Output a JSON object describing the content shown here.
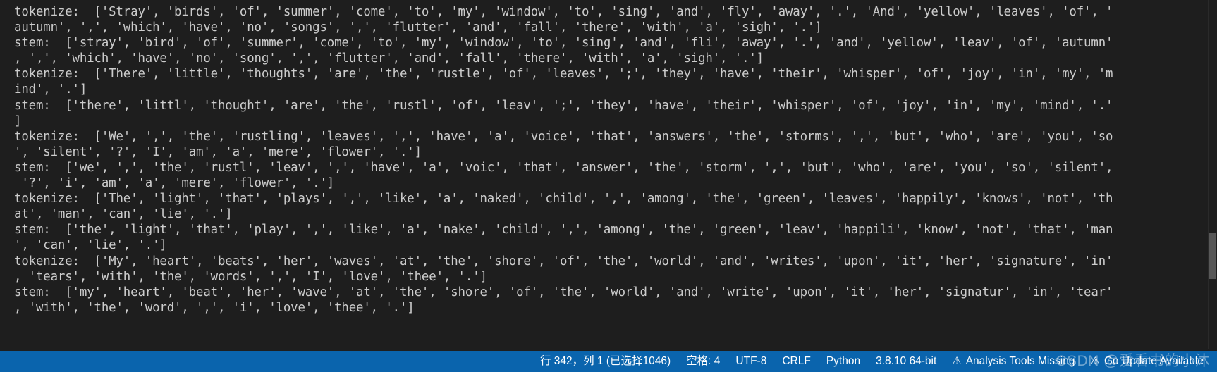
{
  "terminal": {
    "lines": [
      "tokenize:  ['Stray', 'birds', 'of', 'summer', 'come', 'to', 'my', 'window', 'to', 'sing', 'and', 'fly', 'away', '.', 'And', 'yellow', 'leaves', 'of', '",
      "autumn', ',', 'which', 'have', 'no', 'songs', ',', 'flutter', 'and', 'fall', 'there', 'with', 'a', 'sigh', '.']",
      "stem:  ['stray', 'bird', 'of', 'summer', 'come', 'to', 'my', 'window', 'to', 'sing', 'and', 'fli', 'away', '.', 'and', 'yellow', 'leav', 'of', 'autumn'",
      ", ',', 'which', 'have', 'no', 'song', ',', 'flutter', 'and', 'fall', 'there', 'with', 'a', 'sigh', '.']",
      "tokenize:  ['There', 'little', 'thoughts', 'are', 'the', 'rustle', 'of', 'leaves', ';', 'they', 'have', 'their', 'whisper', 'of', 'joy', 'in', 'my', 'm",
      "ind', '.']",
      "stem:  ['there', 'littl', 'thought', 'are', 'the', 'rustl', 'of', 'leav', ';', 'they', 'have', 'their', 'whisper', 'of', 'joy', 'in', 'my', 'mind', '.'",
      "]",
      "tokenize:  ['We', ',', 'the', 'rustling', 'leaves', ',', 'have', 'a', 'voice', 'that', 'answers', 'the', 'storms', ',', 'but', 'who', 'are', 'you', 'so",
      "', 'silent', '?', 'I', 'am', 'a', 'mere', 'flower', '.']",
      "stem:  ['we', ',', 'the', 'rustl', 'leav', ',', 'have', 'a', 'voic', 'that', 'answer', 'the', 'storm', ',', 'but', 'who', 'are', 'you', 'so', 'silent',",
      " '?', 'i', 'am', 'a', 'mere', 'flower', '.']",
      "tokenize:  ['The', 'light', 'that', 'plays', ',', 'like', 'a', 'naked', 'child', ',', 'among', 'the', 'green', 'leaves', 'happily', 'knows', 'not', 'th",
      "at', 'man', 'can', 'lie', '.']",
      "stem:  ['the', 'light', 'that', 'play', ',', 'like', 'a', 'nake', 'child', ',', 'among', 'the', 'green', 'leav', 'happili', 'know', 'not', 'that', 'man",
      "', 'can', 'lie', '.']",
      "tokenize:  ['My', 'heart', 'beats', 'her', 'waves', 'at', 'the', 'shore', 'of', 'the', 'world', 'and', 'writes', 'upon', 'it', 'her', 'signature', 'in'",
      ", 'tears', 'with', 'the', 'words', ',', 'I', 'love', 'thee', '.']",
      "stem:  ['my', 'heart', 'beat', 'her', 'wave', 'at', 'the', 'shore', 'of', 'the', 'world', 'and', 'write', 'upon', 'it', 'her', 'signatur', 'in', 'tear'",
      ", 'with', 'the', 'word', ',', 'i', 'love', 'thee', '.']"
    ]
  },
  "statusbar": {
    "cursor_position": "行 342，列 1 (已选择1046)",
    "indentation": "空格: 4",
    "encoding": "UTF-8",
    "eol": "CRLF",
    "language": "Python",
    "interpreter": "3.8.10 64-bit",
    "analysis_warning": "Analysis Tools Missing",
    "update_warning": "Go Update Available",
    "warning_glyph": "⚠",
    "background_color": "#0a64ad"
  },
  "watermark": {
    "text": "CSDN @爱看书的小沐"
  }
}
